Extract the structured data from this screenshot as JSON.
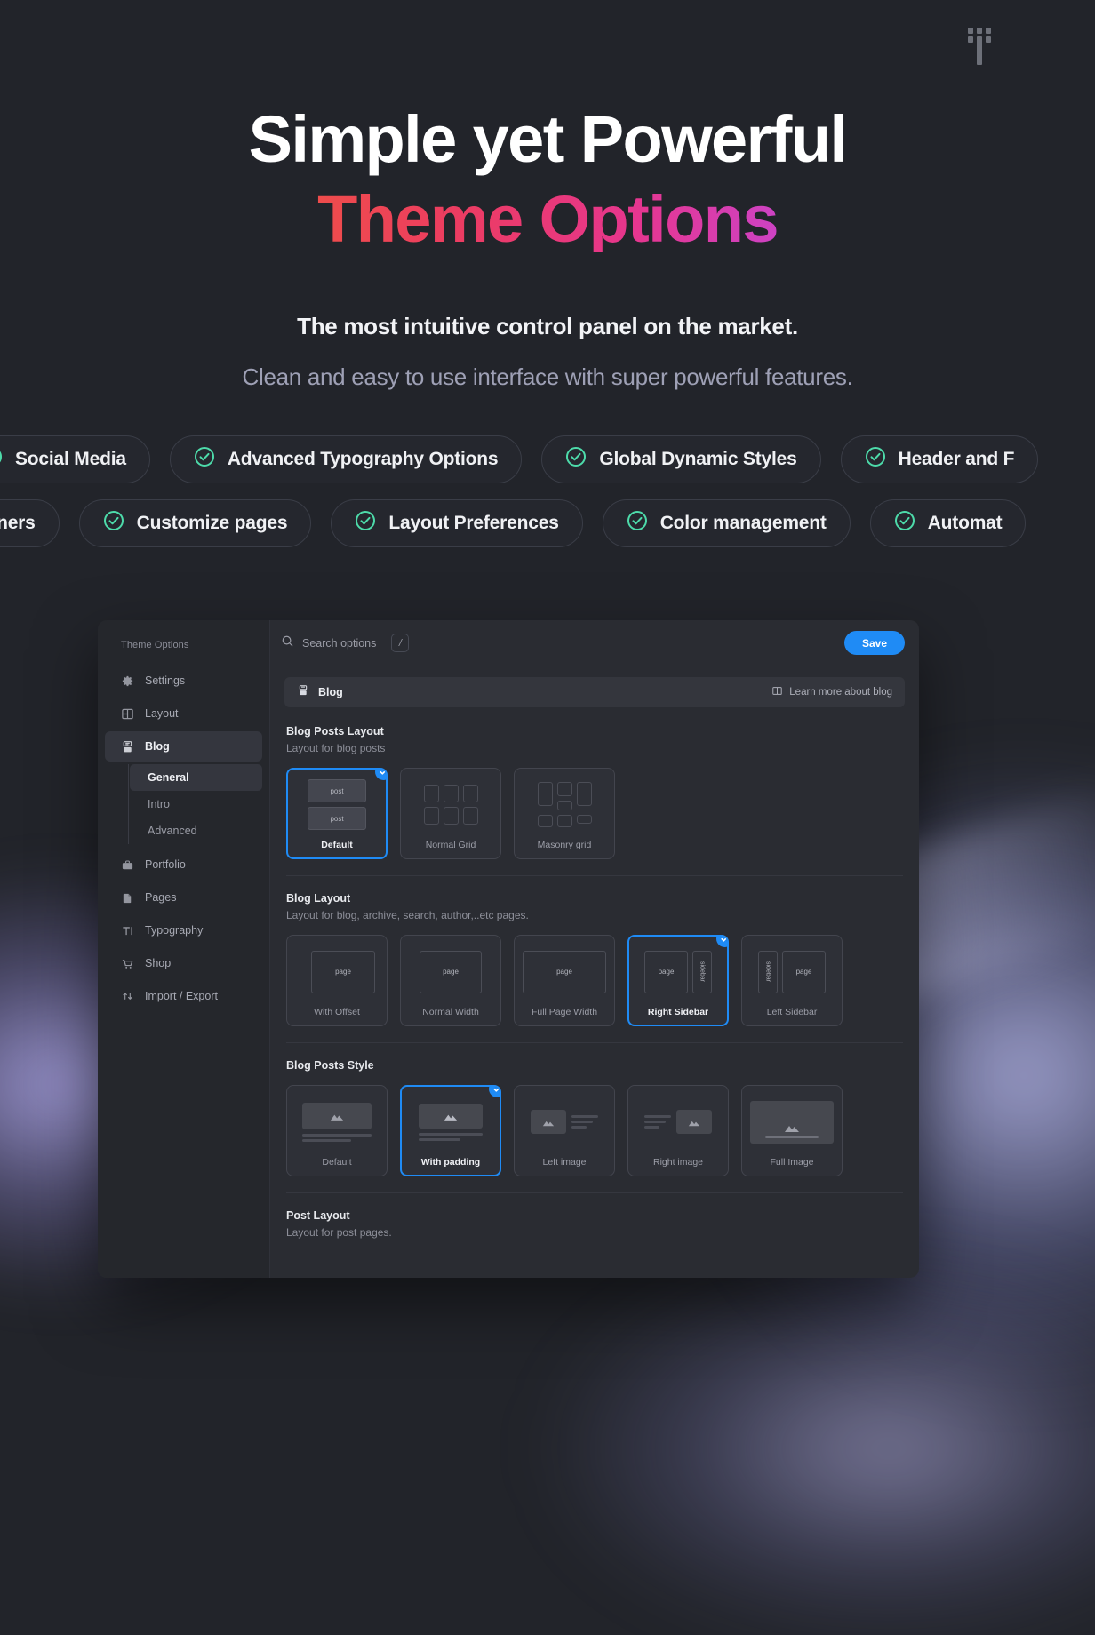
{
  "hero": {
    "headline_line1": "Simple yet Powerful",
    "headline_line2": "Theme Options",
    "subtitle": "The most intuitive control panel on the market.",
    "description": "Clean and easy to use interface with super powerful features.",
    "gradient_start": "#f7943e",
    "gradient_mid": "#ec3c62",
    "gradient_end": "#9b4df0"
  },
  "features": {
    "accent_color": "#4ddbaa",
    "row1": [
      "Social Media",
      "Advanced Typography Options",
      "Global Dynamic Styles",
      "Header and F"
    ],
    "row2": [
      "Banners",
      "Customize pages",
      "Layout Preferences",
      "Color management",
      "Automat"
    ]
  },
  "app": {
    "accent_blue": "#1f8bf5",
    "sidebar": {
      "title": "Theme Options",
      "items": [
        {
          "label": "Settings",
          "icon": "gear-icon"
        },
        {
          "label": "Layout",
          "icon": "layout-icon"
        },
        {
          "label": "Blog",
          "icon": "blog-icon"
        },
        {
          "label": "Portfolio",
          "icon": "briefcase-icon"
        },
        {
          "label": "Pages",
          "icon": "pages-icon"
        },
        {
          "label": "Typography",
          "icon": "typography-icon"
        },
        {
          "label": "Shop",
          "icon": "cart-icon"
        },
        {
          "label": "Import / Export",
          "icon": "import-export-icon"
        }
      ],
      "active_item": "Blog",
      "subitems": [
        {
          "label": "General"
        },
        {
          "label": "Intro"
        },
        {
          "label": "Advanced"
        }
      ],
      "active_subitem": "General"
    },
    "topbar": {
      "search_placeholder": "Search options",
      "search_shortcut": "/",
      "save_label": "Save"
    },
    "section": {
      "title": "Blog",
      "learn_more": "Learn more about blog"
    },
    "groups": [
      {
        "title": "Blog Posts Layout",
        "desc": "Layout for blog posts",
        "options": [
          {
            "label": "Default",
            "selected": true
          },
          {
            "label": "Normal Grid",
            "selected": false
          },
          {
            "label": "Masonry grid",
            "selected": false
          }
        ]
      },
      {
        "title": "Blog Layout",
        "desc": "Layout for blog, archive, search, author,..etc pages.",
        "options": [
          {
            "label": "With Offset",
            "selected": false
          },
          {
            "label": "Normal Width",
            "selected": false
          },
          {
            "label": "Full Page Width",
            "selected": false
          },
          {
            "label": "Right Sidebar",
            "selected": true
          },
          {
            "label": "Left Sidebar",
            "selected": false
          }
        ]
      },
      {
        "title": "Blog Posts Style",
        "desc": "",
        "options": [
          {
            "label": "Default",
            "selected": false
          },
          {
            "label": "With padding",
            "selected": true
          },
          {
            "label": "Left image",
            "selected": false
          },
          {
            "label": "Right image",
            "selected": false
          },
          {
            "label": "Full Image",
            "selected": false
          }
        ]
      },
      {
        "title": "Post Layout",
        "desc": "Layout for post pages.",
        "options": []
      }
    ],
    "preview_labels": {
      "post": "post",
      "page": "page",
      "sidebar": "sidebar"
    }
  }
}
